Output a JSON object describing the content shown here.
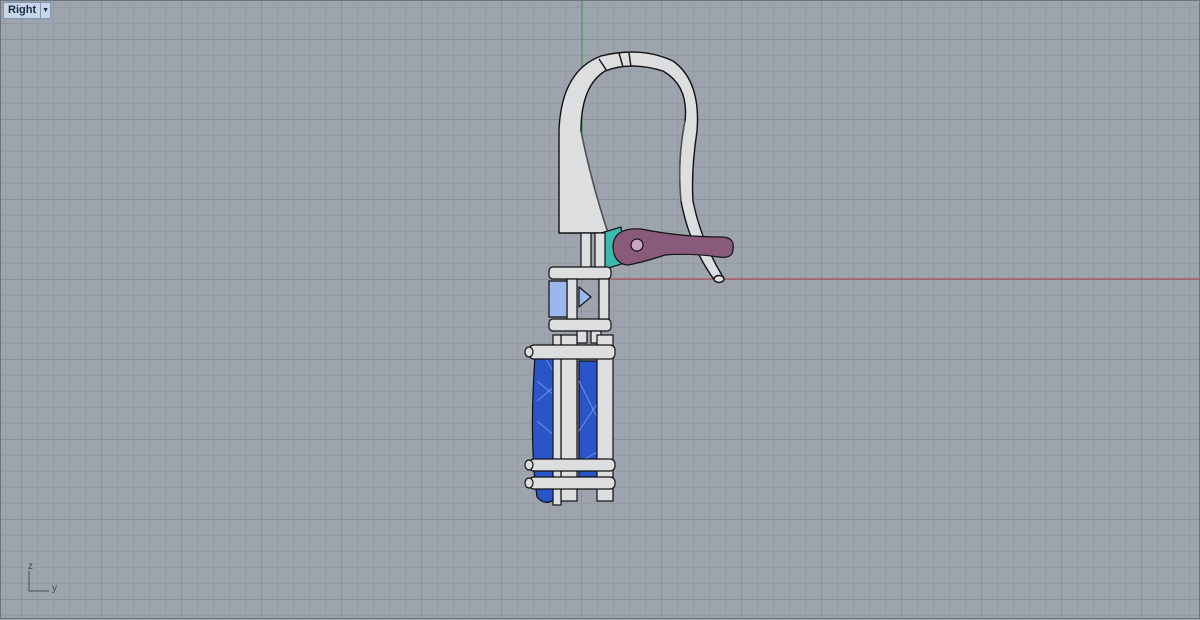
{
  "viewport": {
    "name": "Right",
    "menu_icon": "chevron-down-icon"
  },
  "axes_widget": {
    "vertical_label": "z",
    "horizontal_label": "y"
  },
  "colors": {
    "background": "#9ea4ad",
    "grid_major": "#8b919a",
    "grid_minor": "#959ba4",
    "x_axis": "#b04048",
    "y_axis": "#3aa04a",
    "metal": "#d9dbdd",
    "gem": "#2a55c8",
    "lever": "#8a5a7a",
    "hinge": "#3fb8b0"
  }
}
